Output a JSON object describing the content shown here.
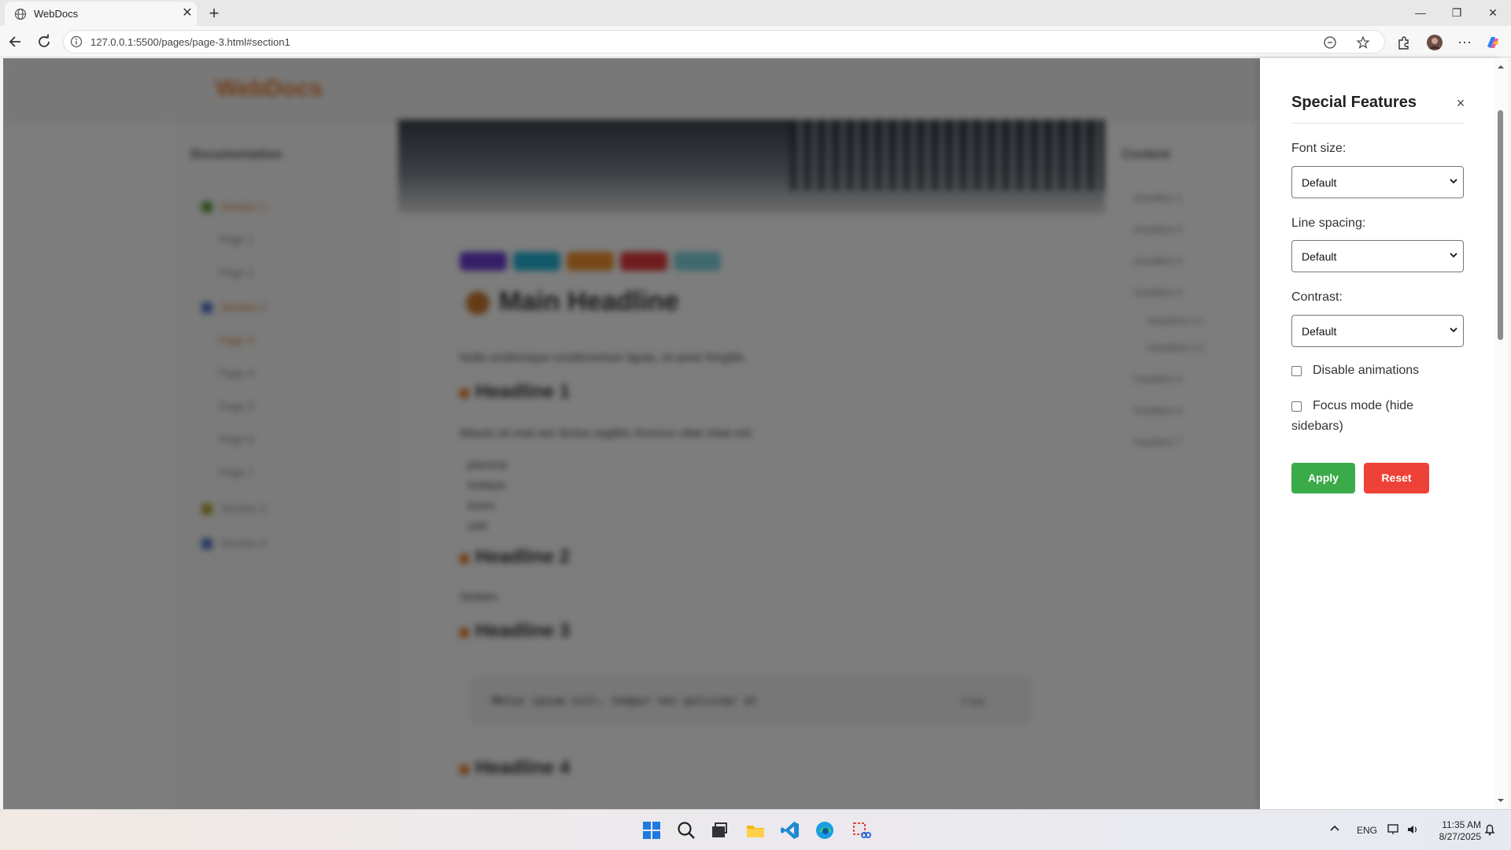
{
  "browser": {
    "tab_title": "WebDocs",
    "url": "127.0.0.1:5500/pages/page-3.html#section1",
    "new_tab_label": "+"
  },
  "page": {
    "logo": "WebDocs",
    "sidebar": {
      "title": "Documentation",
      "items": [
        "Section 1",
        "Page 1",
        "Page 2",
        "Section 2",
        "Page 3",
        "Page 4",
        "Page 5",
        "Page 6",
        "Page 7",
        "Section 3",
        "Section 4"
      ]
    },
    "main": {
      "headline": "Main Headline",
      "intro": "Nulla scelerisque condimentum ligula, sit amet fringilla.",
      "h1": "Headline 1",
      "p1": "Mauris sit erat nec lectus sagittis rhoncus vitae vitae est.",
      "list": [
        "placerat",
        "tristique",
        "lorem",
        "velit"
      ],
      "h2": "Headline 2",
      "p2": "Sedam.",
      "h3": "Headline 3",
      "code": "Metus ipsum nisl, tempor nec pulvinar at",
      "copy_label": "Copy",
      "h4": "Headline 4"
    },
    "toc": {
      "title": "Content",
      "items": [
        "Headline 1",
        "Headline 2",
        "Headline 3",
        "Headline 4",
        "Headline 4.1",
        "Headline 4.2",
        "Headline 5",
        "Headline 6",
        "Headline 7"
      ]
    }
  },
  "panel": {
    "title": "Special Features",
    "close_label": "×",
    "font_size_label": "Font size:",
    "font_size_value": "Default",
    "line_spacing_label": "Line spacing:",
    "line_spacing_value": "Default",
    "contrast_label": "Contrast:",
    "contrast_value": "Default",
    "disable_animations_label": "Disable animations",
    "disable_animations_checked": false,
    "focus_mode_label": "Focus mode (hide sidebars)",
    "focus_mode_checked": false,
    "apply_label": "Apply",
    "reset_label": "Reset",
    "apply_color": "#3bab4a",
    "reset_color": "#ee4137"
  },
  "taskbar": {
    "language": "ENG",
    "time": "11:35 AM",
    "date": "8/27/2025",
    "apps": [
      "start-icon",
      "search-icon",
      "task-view-icon",
      "file-explorer-icon",
      "vscode-icon",
      "edge-icon",
      "snipping-tool-icon"
    ]
  }
}
